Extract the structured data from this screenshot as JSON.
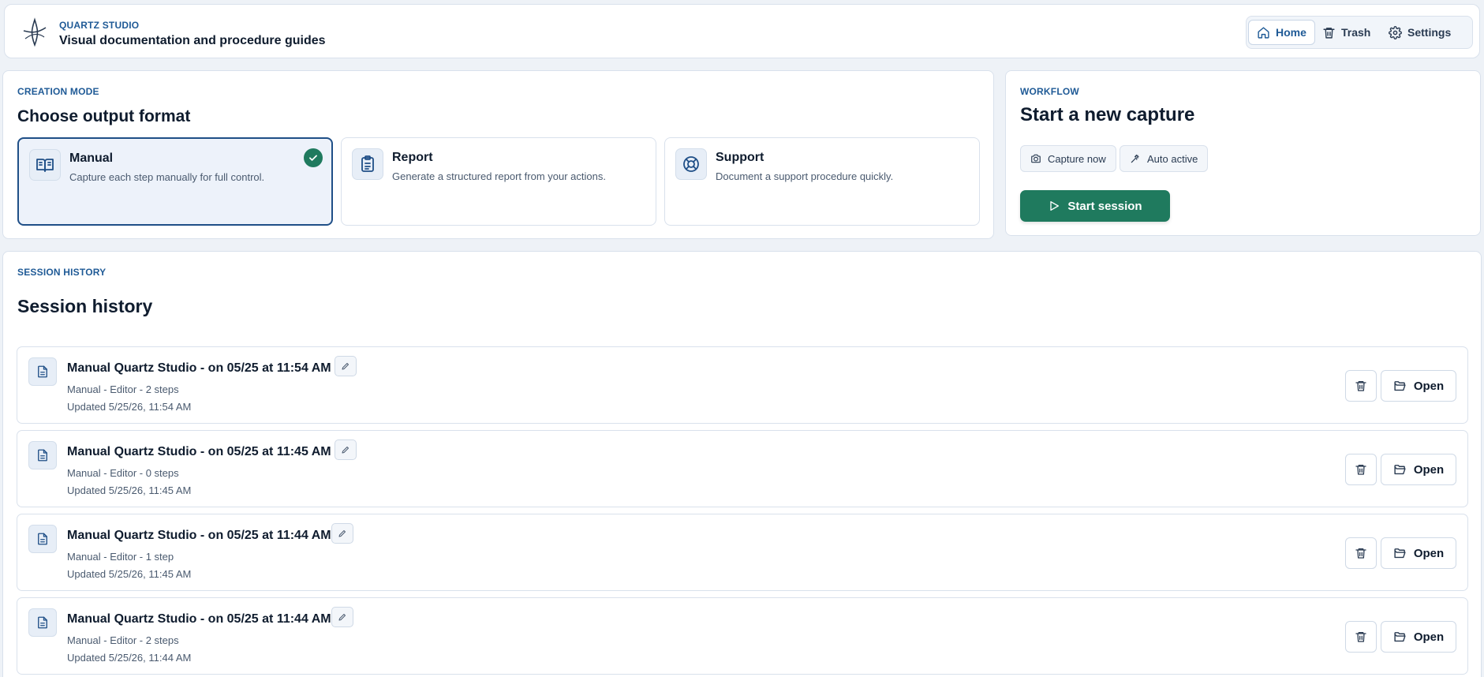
{
  "header": {
    "overline": "QUARTZ STUDIO",
    "title": "Visual documentation and procedure guides",
    "nav": [
      {
        "label": "Home",
        "icon": "home-icon",
        "active": true
      },
      {
        "label": "Trash",
        "icon": "trash-icon",
        "active": false
      },
      {
        "label": "Settings",
        "icon": "gear-icon",
        "active": false
      }
    ]
  },
  "creation": {
    "overline": "CREATION MODE",
    "title": "Choose output format",
    "modes": [
      {
        "title": "Manual",
        "description": "Capture each step manually for full control.",
        "icon": "book-open-icon",
        "selected": true
      },
      {
        "title": "Report",
        "description": "Generate a structured report from your actions.",
        "icon": "clipboard-list-icon",
        "selected": false
      },
      {
        "title": "Support",
        "description": "Document a support procedure quickly.",
        "icon": "lifebuoy-icon",
        "selected": false
      }
    ]
  },
  "workflow": {
    "overline": "WORKFLOW",
    "title": "Start a new capture",
    "capture_now": "Capture now",
    "auto_active": "Auto active",
    "start_label": "Start session"
  },
  "history": {
    "overline": "SESSION HISTORY",
    "title": "Session history",
    "open_label": "Open",
    "sessions": [
      {
        "title": "Manual Quartz Studio - on 05/25 at 11:54 AM",
        "meta": "Manual - Editor - 2 steps",
        "updated": "Updated 5/25/26, 11:54 AM"
      },
      {
        "title": "Manual Quartz Studio - on 05/25 at 11:45 AM",
        "meta": "Manual - Editor - 0 steps",
        "updated": "Updated 5/25/26, 11:45 AM"
      },
      {
        "title": "Manual Quartz Studio - on 05/25 at 11:44 AM",
        "meta": "Manual - Editor - 1 step",
        "updated": "Updated 5/25/26, 11:45 AM"
      },
      {
        "title": "Manual Quartz Studio - on 05/25 at 11:44 AM",
        "meta": "Manual - Editor - 2 steps",
        "updated": "Updated 5/25/26, 11:44 AM"
      }
    ]
  },
  "colors": {
    "accent_blue": "#1f5a96",
    "primary_green": "#1f7a5e",
    "text_dark": "#0f1c2e",
    "background": "#eef2f7"
  }
}
